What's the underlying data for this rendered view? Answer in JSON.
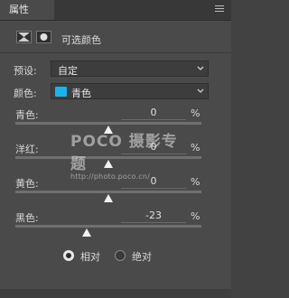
{
  "panel": {
    "tab_title": "属性",
    "adjustment_title": "可选颜色"
  },
  "preset": {
    "label": "预设:",
    "value": "自定"
  },
  "colors": {
    "label": "颜色:",
    "value": "青色",
    "swatch_color": "#1ab3ee"
  },
  "sliders": [
    {
      "label": "青色:",
      "value": "0",
      "unit": "%",
      "level": 0
    },
    {
      "label": "洋红:",
      "value": "0",
      "unit": "%",
      "level": 0
    },
    {
      "label": "黄色:",
      "value": "0",
      "unit": "%",
      "level": 0
    },
    {
      "label": "黑色:",
      "value": "-23",
      "unit": "%",
      "level": -23
    }
  ],
  "method": {
    "relative_label": "相对",
    "absolute_label": "绝对",
    "selected": "relative"
  },
  "watermark": {
    "main": "POCO 摄影专题",
    "sub": "http://photo.poco.cn/"
  },
  "icons": [
    "panel-menu-icon",
    "adjustment-icon",
    "mask-icon",
    "chevron-down-icon",
    "slider-thumb-icon",
    "radio-icon"
  ]
}
